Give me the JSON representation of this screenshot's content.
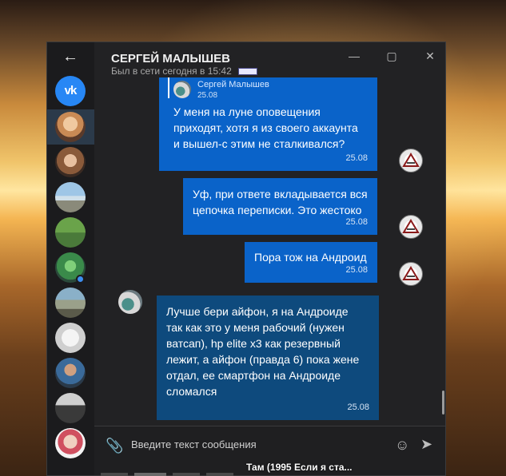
{
  "window": {
    "contact_name": "СЕРГЕЙ МАЛЫШЕВ",
    "status": "Был в сети сегодня в 15:42",
    "controls": {
      "minimize": "—",
      "maximize": "▢",
      "close": "✕"
    }
  },
  "sidebar": {
    "back_icon": "arrow-left-icon",
    "logo_text": "vk",
    "contacts": [
      {
        "name": "contact-1",
        "active": true
      },
      {
        "name": "contact-2",
        "active": false
      },
      {
        "name": "contact-3",
        "active": false
      },
      {
        "name": "contact-4",
        "active": false
      },
      {
        "name": "contact-5",
        "active": false,
        "online": true
      },
      {
        "name": "contact-6",
        "active": false
      },
      {
        "name": "contact-7",
        "active": false
      },
      {
        "name": "contact-8",
        "active": false
      },
      {
        "name": "contact-9",
        "active": false
      },
      {
        "name": "contact-10",
        "active": false
      }
    ]
  },
  "messages": [
    {
      "direction": "out",
      "reply": {
        "author": "Сергей Малышев",
        "date": "25.08"
      },
      "text_lines": [
        "У меня на луне оповещения",
        "приходят, хотя я из своего аккаунта",
        "и вышел-с этим не сталкивался?"
      ],
      "time": "25.08"
    },
    {
      "direction": "out",
      "text_lines": [
        "Уф, при ответе вкладывается вся",
        "цепочка переписки. Это жестоко"
      ],
      "time": "25.08"
    },
    {
      "direction": "out",
      "text_lines": [
        "Пора тож на Андроид"
      ],
      "time": "25.08"
    },
    {
      "direction": "in",
      "text_lines": [
        "Лучше бери айфон, я на Андроиде",
        "так как это у меня рабочий (нужен",
        "ватсап), hp elite x3 как резервный",
        "лежит, а айфон (правда 6) пока жене",
        "отдал, ее смартфон на Андроиде",
        "сломался"
      ],
      "time": "25.08"
    }
  ],
  "composer": {
    "placeholder": "Введите текст сообщения",
    "attach_icon": "paperclip-icon",
    "emoji_icon": "smiley-icon",
    "send_icon": "send-icon"
  },
  "taskbar": {
    "preview_text": "Там (1995 Если я ста..."
  },
  "colors": {
    "outgoing_bubble": "#0a63c9",
    "incoming_bubble": "#0e4a7d",
    "window_bg": "#222224",
    "accent": "#2787f5"
  }
}
